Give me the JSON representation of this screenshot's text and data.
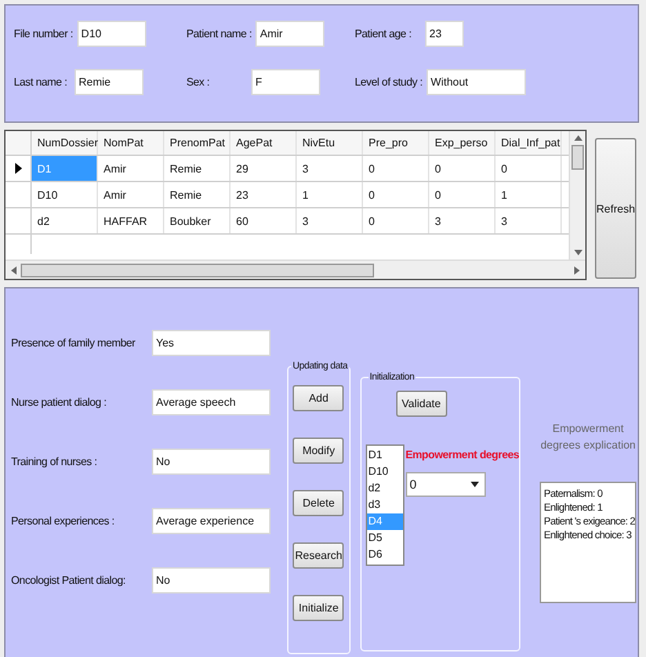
{
  "patient_form": {
    "rows": [
      [
        {
          "label": "File number :",
          "value": "D10"
        },
        {
          "label": "Patient name :",
          "value": "Amir"
        },
        {
          "label": "Patient age :",
          "value": "23"
        }
      ],
      [
        {
          "label": "Last name :",
          "value": "Remie"
        },
        {
          "label": "Sex :",
          "value": "F"
        },
        {
          "label": "Level of study :",
          "value": "Without"
        }
      ]
    ]
  },
  "table": {
    "columns": [
      "NumDossier",
      "NomPat",
      "PrenomPat",
      "AgePat",
      "NivEtu",
      "Pre_pro",
      "Exp_perso",
      "Dial_Inf_pat"
    ],
    "rows": [
      {
        "current": true,
        "cells": [
          {
            "text": "D1",
            "selected": true
          },
          {
            "text": "Amir",
            "selected": false
          },
          {
            "text": "Remie",
            "selected": false
          },
          {
            "text": "29",
            "selected": false
          },
          {
            "text": "3",
            "selected": false
          },
          {
            "text": "0",
            "selected": false
          },
          {
            "text": "0",
            "selected": false
          },
          {
            "text": "0",
            "selected": false
          }
        ]
      },
      {
        "current": false,
        "cells": [
          {
            "text": "D10",
            "selected": false
          },
          {
            "text": "Amir",
            "selected": false
          },
          {
            "text": "Remie",
            "selected": false
          },
          {
            "text": "23",
            "selected": false
          },
          {
            "text": "1",
            "selected": false
          },
          {
            "text": "0",
            "selected": false
          },
          {
            "text": "0",
            "selected": false
          },
          {
            "text": "1",
            "selected": false
          }
        ]
      },
      {
        "current": false,
        "cells": [
          {
            "text": "d2",
            "selected": false
          },
          {
            "text": "HAFFAR",
            "selected": false
          },
          {
            "text": "Boubker",
            "selected": false
          },
          {
            "text": "60",
            "selected": false
          },
          {
            "text": "3",
            "selected": false
          },
          {
            "text": "0",
            "selected": false
          },
          {
            "text": "3",
            "selected": false
          },
          {
            "text": "3",
            "selected": false
          }
        ]
      }
    ]
  },
  "refresh_button": "Refresh",
  "criteria": [
    {
      "label": "Presence of family member",
      "value": "Yes"
    },
    {
      "label": "Nurse patient dialog :",
      "value": "Average speech"
    },
    {
      "label": "Training of nurses :",
      "value": "No"
    },
    {
      "label": "Personal experiences :",
      "value": "Average experience"
    },
    {
      "label": "Oncologist Patient dialog:",
      "value": "No"
    }
  ],
  "updating_group": {
    "title": "Updating data",
    "buttons": [
      "Add",
      "Modify",
      "Delete",
      "Research",
      "Initialize"
    ]
  },
  "initialization_group": {
    "title": "Initialization",
    "validate_button": "Validate",
    "list_items": [
      {
        "text": "D1",
        "selected": false
      },
      {
        "text": "D10",
        "selected": false
      },
      {
        "text": "d2",
        "selected": false
      },
      {
        "text": "d3",
        "selected": false
      },
      {
        "text": "D4",
        "selected": true
      },
      {
        "text": "D5",
        "selected": false
      },
      {
        "text": "D6",
        "selected": false
      }
    ],
    "degrees_label": "Empowerment degrees",
    "degree_value": "0"
  },
  "explication": {
    "title": "Empowerment degrees explication",
    "lines": [
      "Paternalism: 0",
      "Enlightened: 1",
      "Patient 's exigeance: 2",
      "Enlightened choice: 3"
    ]
  }
}
